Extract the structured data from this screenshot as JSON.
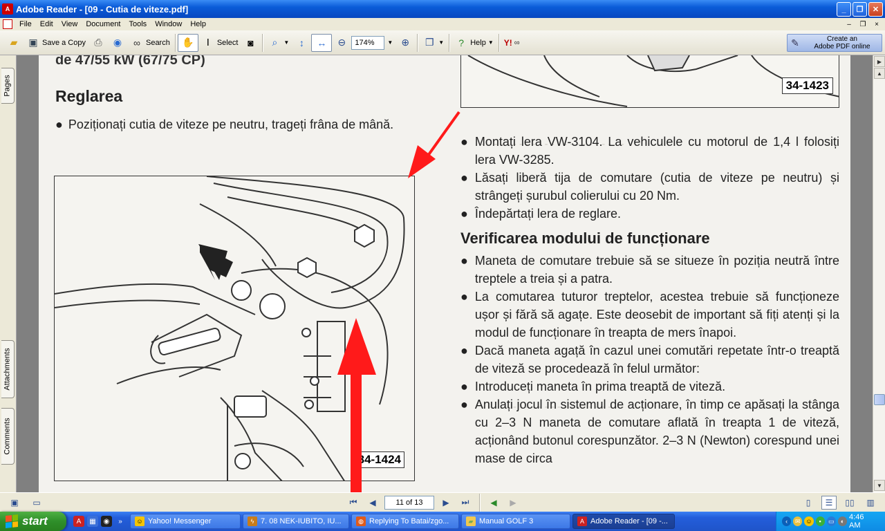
{
  "window": {
    "title": "Adobe Reader - [09 - Cutia de viteze.pdf]",
    "min": "_",
    "max": "❐",
    "close": "✕"
  },
  "menu": {
    "items": [
      "File",
      "Edit",
      "View",
      "Document",
      "Tools",
      "Window",
      "Help"
    ],
    "mdi": [
      "–",
      "❐",
      "×"
    ]
  },
  "toolbar": {
    "save_copy": "Save a Copy",
    "search": "Search",
    "select": "Select",
    "zoom_value": "174%",
    "help": "Help",
    "create_pdf_line1": "Create an",
    "create_pdf_line2": "Adobe PDF online",
    "yahoo": "Y!"
  },
  "side_tabs": {
    "pages": "Pages",
    "attachments": "Attachments",
    "comments": "Comments"
  },
  "document": {
    "left_top_heading": "de 47/55 kW (67/75 CP)",
    "left_heading": "Reglarea",
    "left_bullet": "Poziționați cutia de viteze pe neutru, trageți frâna de mână.",
    "figure_left_label": "34-1424",
    "figure_right_label": "34-1423",
    "right_bullets_1": [
      "Montați lera VW-3104. La vehiculele cu motorul de 1,4 l folosiți lera VW-3285.",
      "Lăsați liberă tija de comutare (cutia de viteze pe neutru) și strângeți șurubul colierului cu 20 Nm.",
      "Îndepărtați lera de reglare."
    ],
    "right_heading": "Verificarea modului de funcționare",
    "right_bullets_2": [
      "Maneta de comutare trebuie să se situeze în poziția neutră între treptele a treia și a patra.",
      "La comutarea tuturor treptelor, acestea trebuie să funcționeze ușor și fără să agațe. Este deosebit de important să fiți atenți și la modul de funcționare în treapta de mers înapoi.",
      "Dacă maneta agață în cazul unei comutări repetate într-o treaptă de viteză se procedează în felul următor:",
      "Introduceți maneta în prima treaptă de viteză.",
      "Anulați jocul în sistemul de acționare, în timp ce apăsați la stânga cu 2–3 N maneta de comutare aflată în treapta 1 de viteză, acționând butonul corespunzător. 2–3 N (Newton) corespund unei mase de circa"
    ]
  },
  "status": {
    "page_indicator": "11 of 13"
  },
  "taskbar": {
    "start": "start",
    "tasks": [
      "Yahoo! Messenger",
      "7. 08 NEK-IUBITO, IU...",
      "Replying To Batai/zgo...",
      "Manual GOLF 3",
      "Adobe Reader - [09 -..."
    ],
    "clock": "4:46 AM"
  },
  "colors": {
    "annotation_arrow": "#ff1a1a",
    "titlebar": "#0a5bd8",
    "taskbar": "#245edb",
    "start": "#2f8f2a"
  }
}
